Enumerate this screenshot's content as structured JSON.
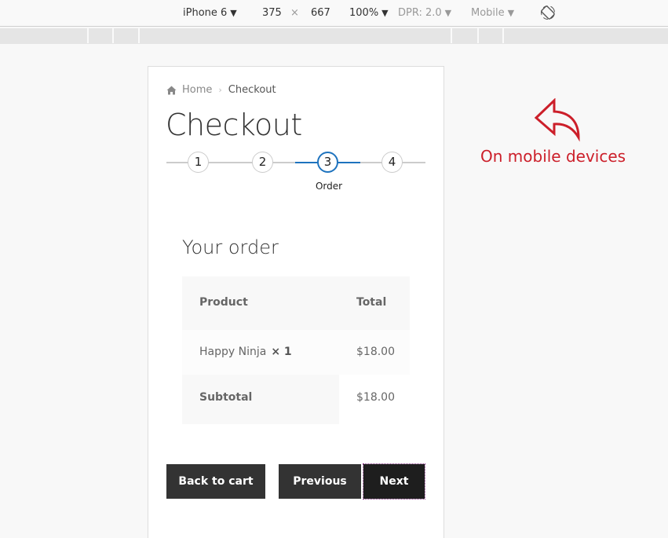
{
  "devtools": {
    "device": "iPhone 6",
    "width": "375",
    "times": "×",
    "height": "667",
    "zoom": "100%",
    "dpr": "DPR: 2.0",
    "mode": "Mobile",
    "caret": "▼"
  },
  "breadcrumb": {
    "home": "Home",
    "separator": "›",
    "current": "Checkout"
  },
  "page": {
    "title": "Checkout"
  },
  "steps": {
    "items": [
      "1",
      "2",
      "3",
      "4"
    ],
    "active_index": 2,
    "active_label": "Order"
  },
  "order": {
    "title": "Your order",
    "columns": [
      "Product",
      "Total"
    ],
    "items": [
      {
        "name": "Happy Ninja",
        "qty": "× 1",
        "total": "$18.00"
      }
    ],
    "subtotal_label": "Subtotal",
    "subtotal_value": "$18.00"
  },
  "buttons": {
    "back": "Back to cart",
    "previous": "Previous",
    "next": "Next"
  },
  "annotation": {
    "text": "On mobile devices",
    "color": "#cc1f2a"
  },
  "colors": {
    "accent": "#1e73be",
    "button": "#333333"
  }
}
